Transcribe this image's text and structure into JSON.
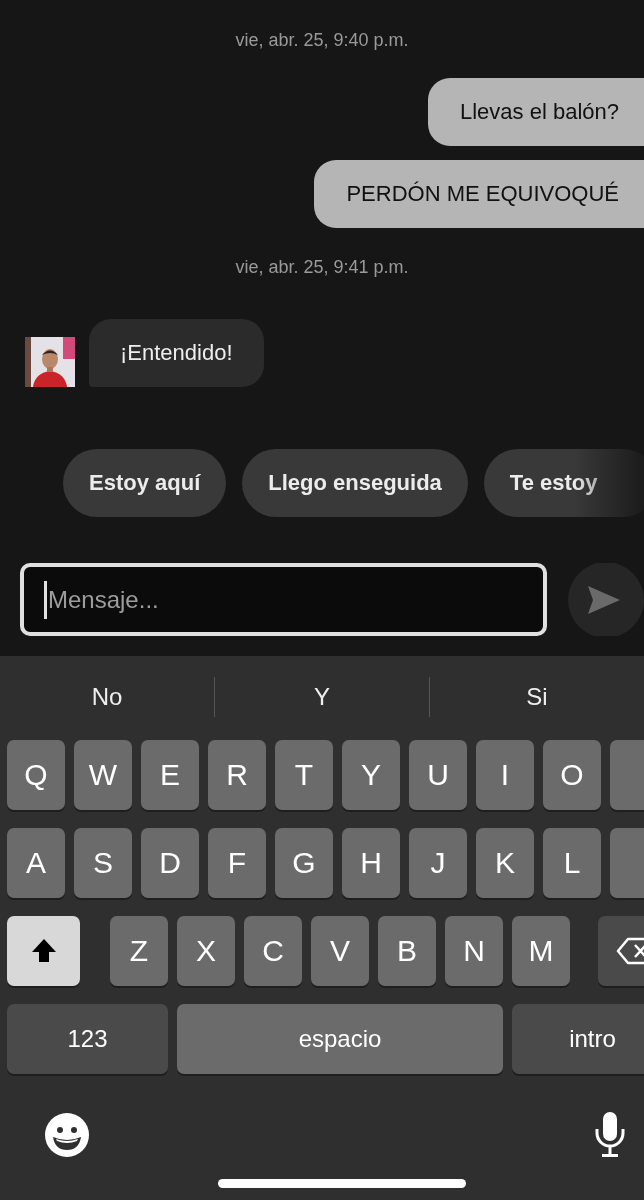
{
  "messages": [
    {
      "kind": "timestamp",
      "text": "vie, abr. 25, 9:40 p.m."
    },
    {
      "kind": "sent",
      "text": "Llevas el balón?"
    },
    {
      "kind": "sent",
      "text": "PERDÓN ME EQUIVOQUÉ"
    },
    {
      "kind": "timestamp",
      "text": "vie, abr. 25, 9:41 p.m."
    },
    {
      "kind": "received",
      "text": "¡Entendido!"
    }
  ],
  "quick_replies": [
    "Estoy aquí",
    "Llego enseguida",
    "Te estoy"
  ],
  "composer": {
    "placeholder": "Mensaje...",
    "focused": true
  },
  "keyboard": {
    "suggestions": [
      "No",
      "Y",
      "Si"
    ],
    "rows": [
      [
        {
          "kind": "letter",
          "label": "Q"
        },
        {
          "kind": "letter",
          "label": "W"
        },
        {
          "kind": "letter",
          "label": "E"
        },
        {
          "kind": "letter",
          "label": "R"
        },
        {
          "kind": "letter",
          "label": "T"
        },
        {
          "kind": "letter",
          "label": "Y"
        },
        {
          "kind": "letter",
          "label": "U"
        },
        {
          "kind": "letter",
          "label": "I"
        },
        {
          "kind": "letter",
          "label": "O"
        },
        {
          "kind": "cut_key"
        }
      ],
      [
        {
          "kind": "letter",
          "label": "A"
        },
        {
          "kind": "letter",
          "label": "S"
        },
        {
          "kind": "letter",
          "label": "D"
        },
        {
          "kind": "letter",
          "label": "F"
        },
        {
          "kind": "letter",
          "label": "G"
        },
        {
          "kind": "letter",
          "label": "H"
        },
        {
          "kind": "letter",
          "label": "J"
        },
        {
          "kind": "letter",
          "label": "K"
        },
        {
          "kind": "letter",
          "label": "L"
        },
        {
          "kind": "cut_key"
        }
      ],
      [
        {
          "kind": "shift",
          "on": true
        },
        {
          "kind": "letter",
          "label": "Z"
        },
        {
          "kind": "letter",
          "label": "X"
        },
        {
          "kind": "letter",
          "label": "C"
        },
        {
          "kind": "letter",
          "label": "V"
        },
        {
          "kind": "letter",
          "label": "B"
        },
        {
          "kind": "letter",
          "label": "N"
        },
        {
          "kind": "letter",
          "label": "M"
        },
        {
          "kind": "backspace"
        }
      ]
    ],
    "bottom_row": [
      {
        "kind": "mode",
        "label": "123"
      },
      {
        "kind": "space",
        "label": "espacio"
      },
      {
        "kind": "return",
        "label": "intro"
      }
    ]
  }
}
